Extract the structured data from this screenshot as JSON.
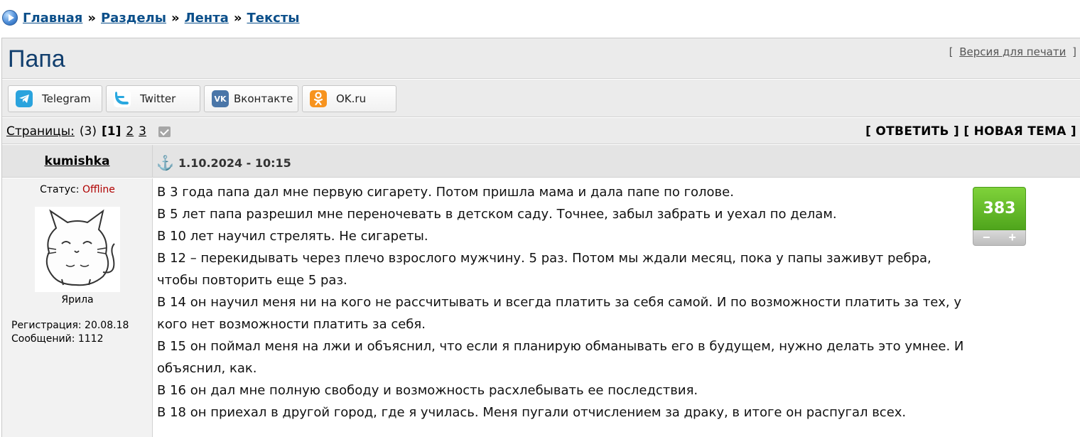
{
  "breadcrumb": {
    "items": [
      "Главная",
      "Разделы",
      "Лента",
      "Тексты"
    ],
    "separator": "»"
  },
  "topic": {
    "title": "Папа",
    "print_link": "Версия для печати",
    "print_open": "[",
    "print_close": "]"
  },
  "share": [
    {
      "label": "Telegram",
      "icon": "telegram-icon"
    },
    {
      "label": "Twitter",
      "icon": "twitter-icon"
    },
    {
      "label": "Вконтакте",
      "icon": "vk-icon"
    },
    {
      "label": "OK.ru",
      "icon": "ok-icon"
    }
  ],
  "pagination": {
    "label": "Страницы:",
    "count": "(3)",
    "current": "[1]",
    "pages": [
      "2",
      "3"
    ],
    "reply": "[ ОТВЕТИТЬ ]",
    "new_topic": "[ НОВАЯ ТЕМА ]"
  },
  "post": {
    "author": "kumishka",
    "date": "1.10.2024 - 10:15",
    "status_label": "Статус:",
    "status_value": "Offline",
    "avatar_caption": "Ярила",
    "registration": "Регистрация: 20.08.18",
    "messages": "Сообщений: 1112",
    "rating": "383",
    "rating_minus": "−",
    "rating_plus": "+",
    "lines": [
      "В 3 года папа дал мне первую сигарету. Потом пришла мама и дала папе по голове.",
      "В 5 лет папа разрешил мне переночевать в детском саду. Точнее, забыл забрать и уехал по делам.",
      "В 10 лет научил стрелять. Не сигареты.",
      "В 12 – перекидывать через плечо взрослого мужчину. 5 раз. Потом мы ждали месяц, пока у папы заживут ребра, чтобы повторить еще 5 раз.",
      "В 14 он научил меня ни на кого не рассчитывать и всегда платить за себя самой. И по возможности платить за тех, у кого нет возможности платить за себя.",
      "В 15 он поймал меня на лжи и объяснил, что если я планирую обманывать его в будущем, нужно делать это умнее. И объяснил, как.",
      "В 16 он дал мне полную свободу и возможность расхлебывать ее последствия.",
      "В 18 он приехал в другой город, где я училась. Меня пугали отчислением за драку, в итоге он распугал всех."
    ]
  },
  "colors": {
    "link": "#0b4f8a",
    "title": "#123f6e",
    "offline": "#b00000",
    "rating_green": "#5cb32a"
  }
}
